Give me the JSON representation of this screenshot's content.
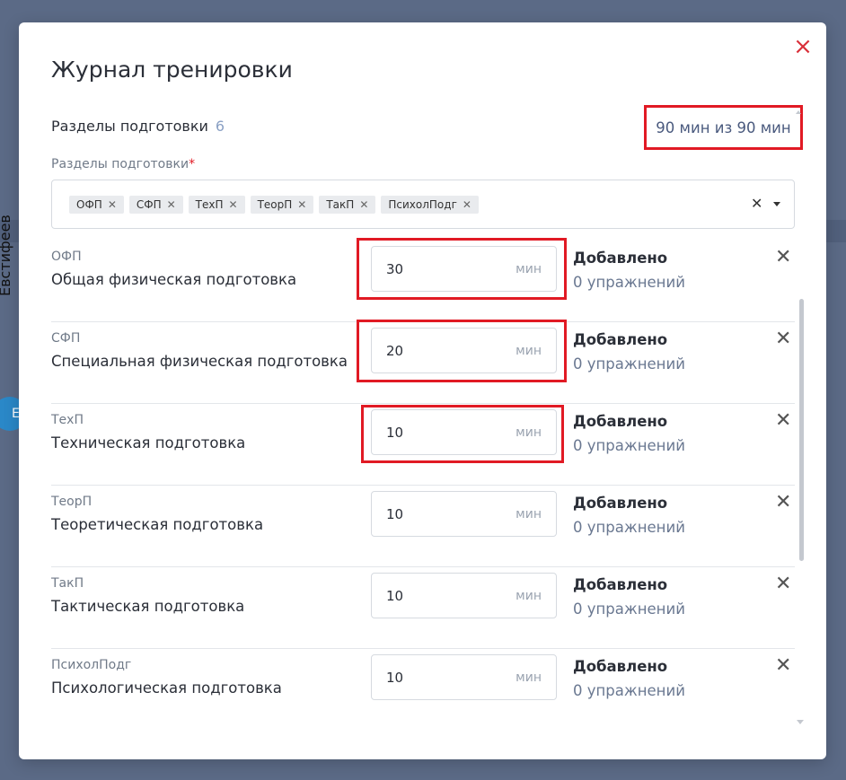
{
  "background": {
    "side_name": "Евстифеев",
    "avatar_initials": "ЕІ"
  },
  "modal": {
    "title": "Журнал тренировки",
    "sections_label": "Разделы подготовки",
    "sections_count": "6",
    "total_time": "90 мин из 90 мин",
    "select_label": "Разделы подготовки",
    "required_mark": "*",
    "tags": [
      "ОФП",
      "СФП",
      "ТехП",
      "ТеорП",
      "ТакП",
      "ПсихолПодг"
    ],
    "sections": [
      {
        "short": "ОФП",
        "full": "Общая физическая подготовка",
        "minutes": "30",
        "unit": "мин",
        "added_title": "Добавлено",
        "added_count": "0 упражнений"
      },
      {
        "short": "СФП",
        "full": "Специальная физическая подготовка",
        "minutes": "20",
        "unit": "мин",
        "added_title": "Добавлено",
        "added_count": "0 упражнений"
      },
      {
        "short": "ТехП",
        "full": "Техническая подготовка",
        "minutes": "10",
        "unit": "мин",
        "added_title": "Добавлено",
        "added_count": "0 упражнений"
      },
      {
        "short": "ТеорП",
        "full": "Теоретическая подготовка",
        "minutes": "10",
        "unit": "мин",
        "added_title": "Добавлено",
        "added_count": "0 упражнений"
      },
      {
        "short": "ТакП",
        "full": "Тактическая подготовка",
        "minutes": "10",
        "unit": "мин",
        "added_title": "Добавлено",
        "added_count": "0 упражнений"
      },
      {
        "short": "ПсихолПодг",
        "full": "Психологическая подготовка",
        "minutes": "10",
        "unit": "мин",
        "added_title": "Добавлено",
        "added_count": "0 упражнений"
      }
    ]
  },
  "icons": {
    "close": "close-icon",
    "tag_remove": "close-icon",
    "select_clear": "clear-icon",
    "select_caret": "chevron-down-icon"
  },
  "colors": {
    "highlight": "#e11a24",
    "close": "#d9303a",
    "count_accent": "#8aa0c4"
  }
}
